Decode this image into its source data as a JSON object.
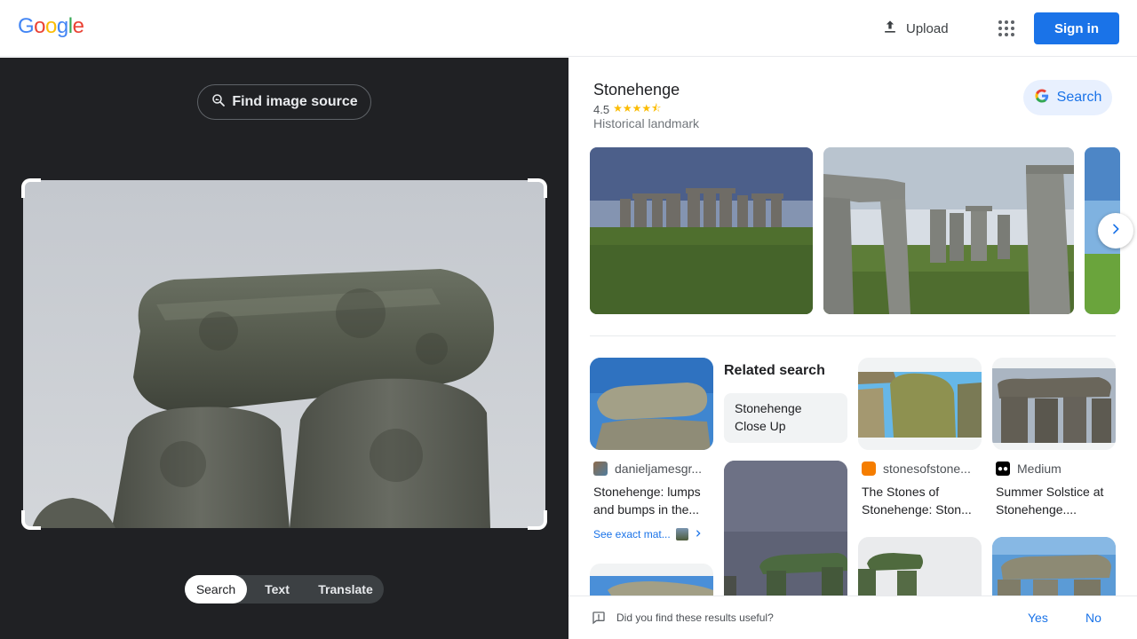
{
  "header": {
    "logo": [
      "G",
      "o",
      "o",
      "g",
      "l",
      "e"
    ],
    "logo_colors": [
      "#4285f4",
      "#ea4335",
      "#fbbc05",
      "#4285f4",
      "#34a853",
      "#ea4335"
    ],
    "upload_label": "Upload",
    "signin_label": "Sign in"
  },
  "left": {
    "find_source_label": "Find image source",
    "modes": [
      "Search",
      "Text",
      "Translate"
    ],
    "active_mode": "Search"
  },
  "knowledge_panel": {
    "title": "Stonehenge",
    "rating": "4.5",
    "stars": "★★★★⯪",
    "type": "Historical landmark",
    "search_label": "Search"
  },
  "related": {
    "heading": "Related search",
    "chip": "Stonehenge Close Up"
  },
  "results": [
    {
      "source": "danieljamesgr...",
      "title": "Stonehenge: lumps and bumps in the...",
      "exact": "See exact mat..."
    },
    {
      "source": "stonesofstone...",
      "title": "The Stones of Stonehenge: Ston..."
    },
    {
      "source": "Medium",
      "title": "Summer Solstice at Stonehenge...."
    }
  ],
  "feedback": {
    "question": "Did you find these results useful?",
    "yes": "Yes",
    "no": "No"
  },
  "colors": {
    "accent": "#1a73e8",
    "dark_panel": "#202124",
    "star": "#fbbc04"
  }
}
